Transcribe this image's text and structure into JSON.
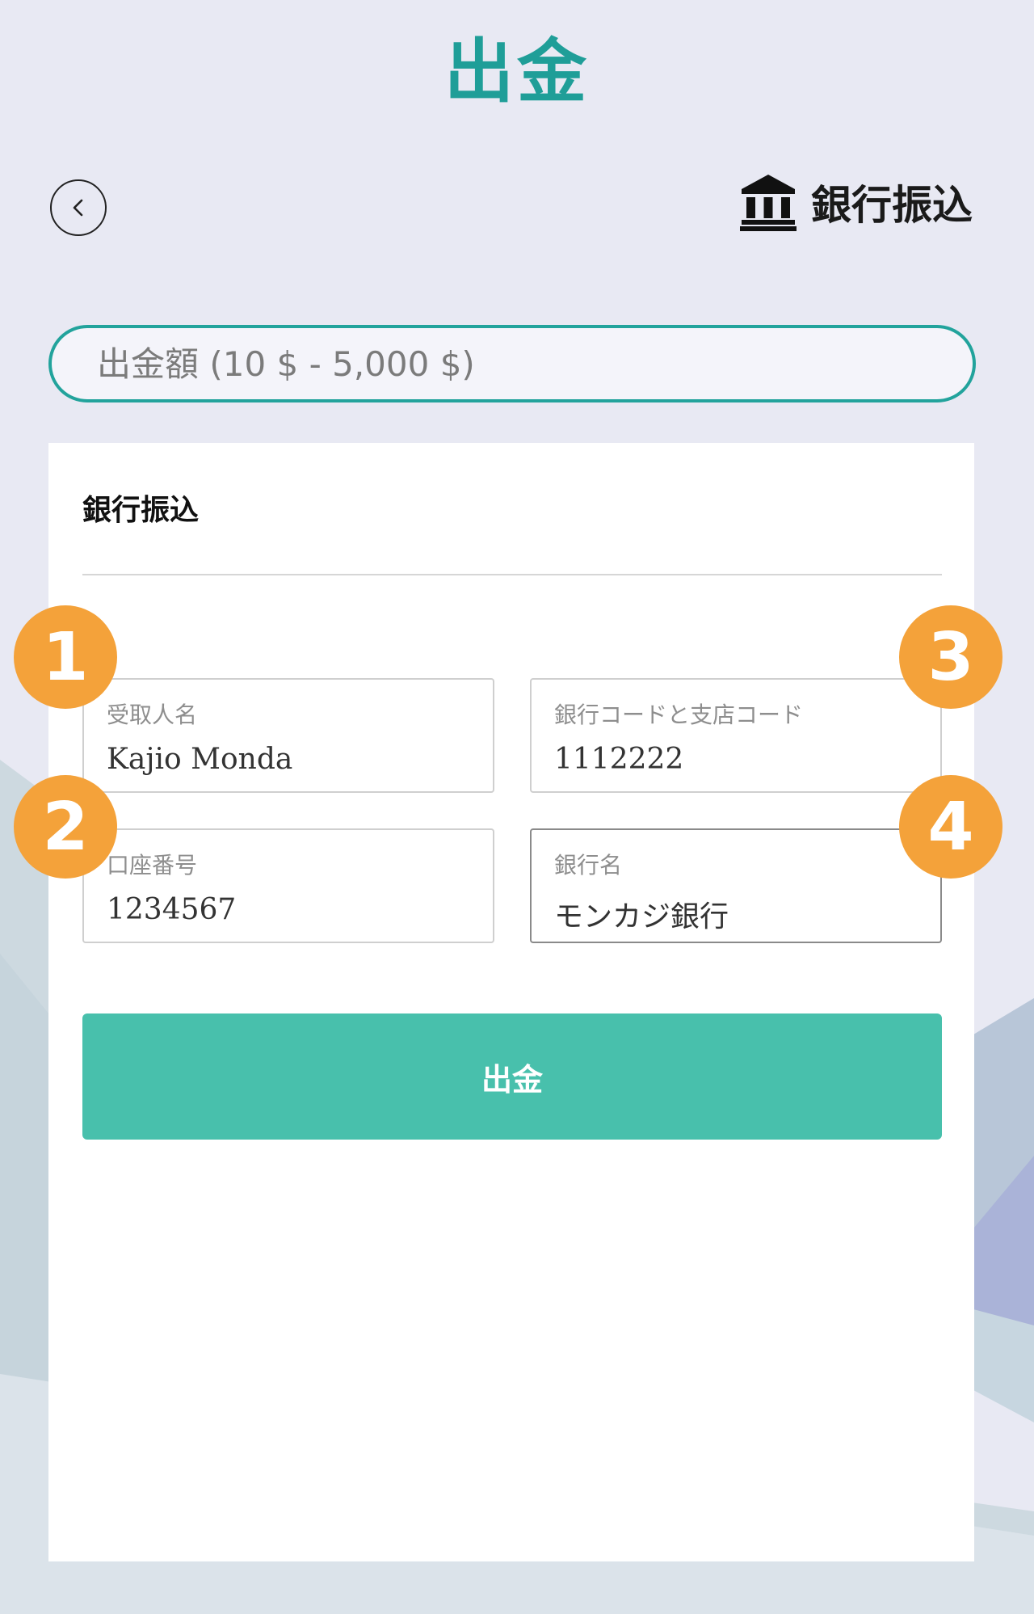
{
  "header": {
    "title": "出金",
    "method_label": "銀行振込",
    "back_icon": "chevron-left-icon",
    "bank_icon": "bank-icon"
  },
  "amount": {
    "placeholder": "出金額 (10 $ - 5,000 $)"
  },
  "form": {
    "title": "銀行振込",
    "fields": [
      {
        "label": "受取人名",
        "value": "Kajio Monda"
      },
      {
        "label": "銀行コードと支店コード",
        "value": "1112222"
      },
      {
        "label": "口座番号",
        "value": "1234567"
      },
      {
        "label": "銀行名",
        "value": "モンカジ銀行"
      }
    ],
    "submit_label": "出金"
  },
  "badges": [
    "1",
    "2",
    "3",
    "4"
  ],
  "colors": {
    "accent": "#1f9e98",
    "submit": "#48c0ac",
    "badge": "#f4a23a",
    "background": "#e8e9f3"
  }
}
